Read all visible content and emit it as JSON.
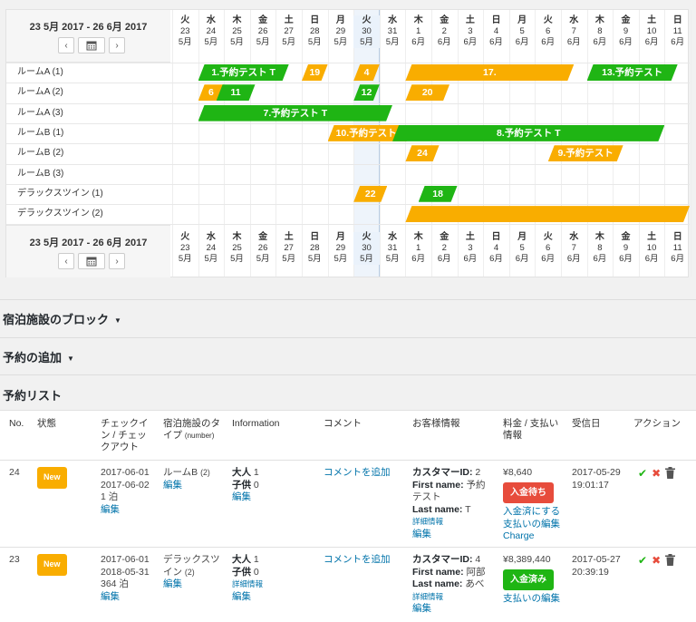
{
  "calendar": {
    "range_label": "23 5月 2017 - 26 6月 2017",
    "prev_label": "‹",
    "next_label": "›",
    "calendar_icon": "calendar-icon",
    "days": [
      {
        "wd": "火",
        "d": "23",
        "m": "5月"
      },
      {
        "wd": "水",
        "d": "24",
        "m": "5月"
      },
      {
        "wd": "木",
        "d": "25",
        "m": "5月"
      },
      {
        "wd": "金",
        "d": "26",
        "m": "5月"
      },
      {
        "wd": "土",
        "d": "27",
        "m": "5月"
      },
      {
        "wd": "日",
        "d": "28",
        "m": "5月"
      },
      {
        "wd": "月",
        "d": "29",
        "m": "5月"
      },
      {
        "wd": "火",
        "d": "30",
        "m": "5月"
      },
      {
        "wd": "水",
        "d": "31",
        "m": "5月"
      },
      {
        "wd": "木",
        "d": "1",
        "m": "6月"
      },
      {
        "wd": "金",
        "d": "2",
        "m": "6月"
      },
      {
        "wd": "土",
        "d": "3",
        "m": "6月"
      },
      {
        "wd": "日",
        "d": "4",
        "m": "6月"
      },
      {
        "wd": "月",
        "d": "5",
        "m": "6月"
      },
      {
        "wd": "火",
        "d": "6",
        "m": "6月"
      },
      {
        "wd": "水",
        "d": "7",
        "m": "6月"
      },
      {
        "wd": "木",
        "d": "8",
        "m": "6月"
      },
      {
        "wd": "金",
        "d": "9",
        "m": "6月"
      },
      {
        "wd": "土",
        "d": "10",
        "m": "6月"
      },
      {
        "wd": "日",
        "d": "11",
        "m": "6月"
      }
    ],
    "today_index": 7,
    "rooms": [
      "ルームA (1)",
      "ルームA (2)",
      "ルームA (3)",
      "ルームB (1)",
      "ルームB (2)",
      "ルームB (3)",
      "デラックスツイン (1)",
      "デラックスツイン (2)"
    ],
    "bookings": [
      {
        "room": 0,
        "start": 1,
        "end": 4.5,
        "label": "1.予約テスト T",
        "color": "green"
      },
      {
        "room": 0,
        "start": 5,
        "end": 6,
        "label": "19",
        "color": "orange"
      },
      {
        "room": 0,
        "start": 7,
        "end": 8,
        "label": "4",
        "color": "orange"
      },
      {
        "room": 0,
        "start": 9,
        "end": 15.5,
        "label": "17.",
        "color": "orange"
      },
      {
        "room": 0,
        "start": 16,
        "end": 19.5,
        "label": "13.予約テスト",
        "color": "green"
      },
      {
        "room": 1,
        "start": 1,
        "end": 2,
        "label": "6",
        "color": "orange"
      },
      {
        "room": 1,
        "start": 1.7,
        "end": 3.2,
        "label": "11",
        "color": "green"
      },
      {
        "room": 1,
        "start": 7,
        "end": 8,
        "label": "12",
        "color": "green"
      },
      {
        "room": 1,
        "start": 9,
        "end": 10.7,
        "label": "20",
        "color": "orange"
      },
      {
        "room": 2,
        "start": 1,
        "end": 8.5,
        "label": "7.予約テスト T",
        "color": "green"
      },
      {
        "room": 3,
        "start": 6,
        "end": 9.3,
        "label": "10.予約テスト T",
        "color": "orange"
      },
      {
        "room": 3,
        "start": 8.5,
        "end": 19,
        "label": "8.予約テスト T",
        "color": "green"
      },
      {
        "room": 4,
        "start": 9,
        "end": 10.3,
        "label": "24",
        "color": "orange"
      },
      {
        "room": 4,
        "start": 14.5,
        "end": 17.4,
        "label": "9.予約テスト",
        "color": "orange"
      },
      {
        "room": 6,
        "start": 7,
        "end": 8.3,
        "label": "22",
        "color": "orange"
      },
      {
        "room": 6,
        "start": 9.5,
        "end": 11,
        "label": "18",
        "color": "green"
      },
      {
        "room": 7,
        "start": 9,
        "end": 20,
        "label": "",
        "color": "orange"
      }
    ]
  },
  "sections": {
    "block": "宿泊施設のブロック",
    "add": "予約の追加",
    "list": "予約リスト",
    "dropdown_arrow": "▼"
  },
  "table": {
    "headers": {
      "no": "No.",
      "status": "状態",
      "checkin": "チェックイン / チェックアウト",
      "type": "宿泊施設のタイプ",
      "type_small": "(number)",
      "info": "Information",
      "comment": "コメント",
      "customer": "お客様情報",
      "price": "料金 / 支払い情報",
      "received": "受信日",
      "action": "アクション"
    },
    "rows": [
      {
        "no": "24",
        "status": "New",
        "checkin": "2017-06-01",
        "checkout": "2017-06-02",
        "nights": "1 泊",
        "edit": "編集",
        "room_type": "ルームB",
        "room_num": "(2)",
        "room_edit": "編集",
        "adults_label": "大人",
        "adults": "1",
        "kids_label": "子供",
        "kids": "0",
        "info_edit": "編集",
        "comment": "コメントを追加",
        "cust_id_label": "カスタマーID:",
        "cust_id": "2",
        "first_label": "First name:",
        "first": "予約",
        "first_cont": "テスト",
        "last_label": "Last name:",
        "last": "T",
        "details": "詳細情報",
        "cust_edit": "編集",
        "price": "¥8,640",
        "pay_status": "入金待ち",
        "pay_link1": "入金済にする",
        "pay_link2": "支払いの編集",
        "pay_link3": "Charge",
        "received_date": "2017-05-29",
        "received_time": "19:01:17"
      },
      {
        "no": "23",
        "status": "New",
        "checkin": "2017-06-01",
        "checkout": "2018-05-31",
        "nights": "364 泊",
        "edit": "編集",
        "room_type": "デラックスツ",
        "room_type2": "イン",
        "room_num": "(2)",
        "room_edit": "編集",
        "adults_label": "大人",
        "adults": "1",
        "kids_label": "子供",
        "kids": "0",
        "info_details": "詳細情報",
        "info_edit": "編集",
        "comment": "コメントを追加",
        "cust_id_label": "カスタマーID:",
        "cust_id": "4",
        "first_label": "First name:",
        "first": "阿部",
        "last_label": "Last name:",
        "last": "あべ",
        "details": "詳細情報",
        "cust_edit": "編集",
        "price": "¥8,389,440",
        "pay_status": "入金済み",
        "pay_link2": "支払いの編集",
        "received_date": "2017-05-27",
        "received_time": "20:39:19"
      }
    ]
  },
  "colors": {
    "green": "#1fb514",
    "orange": "#f9ad00",
    "red": "#e74c3c",
    "link": "#0073aa"
  }
}
